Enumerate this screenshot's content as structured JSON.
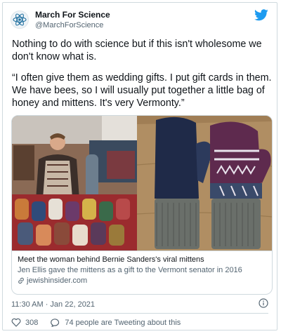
{
  "account": {
    "name": "March For Science",
    "handle": "@MarchForScience",
    "avatar_icon": "atom-logo-icon",
    "brand_color": "#1d9bf0"
  },
  "tweet": {
    "text": "Nothing to do with science but if this isn't wholesome we don't know what is.",
    "quote": "“I often give them as wedding gifts. I put gift cards in them. We have bees, so I will usually put together a little bag of honey and mittens. It's very Vermonty.”"
  },
  "link_card": {
    "title": "Meet the woman behind Bernie Sanders's viral mittens",
    "description": "Jen Ellis gave the mittens as a gift to the Vermont senator in 2016",
    "domain": "jewishinsider.com"
  },
  "meta": {
    "timestamp": "11:30 AM · Jan 22, 2021"
  },
  "actions": {
    "likes": "308",
    "tweeting": "74 people are Tweeting about this"
  }
}
